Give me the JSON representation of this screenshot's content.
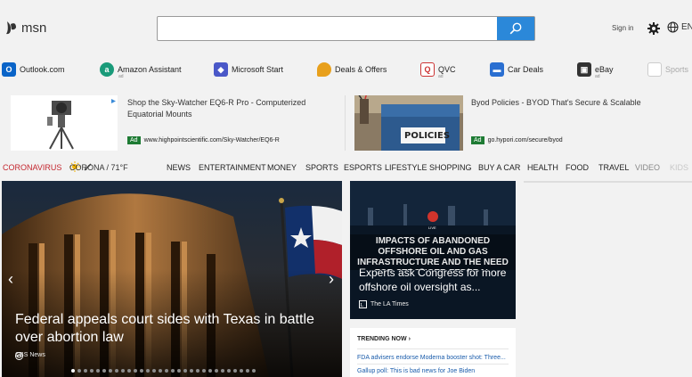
{
  "header": {
    "logo_text": "msn",
    "search_value": "",
    "sign_in": "Sign in",
    "lang": "EN"
  },
  "quick_links": [
    {
      "label": "Outlook.com",
      "icon": "outlook-icon",
      "ad": ""
    },
    {
      "label": "Amazon Assistant",
      "icon": "amazon-icon",
      "ad": "ad"
    },
    {
      "label": "Microsoft Start",
      "icon": "microsoft-start-icon",
      "ad": ""
    },
    {
      "label": "Deals & Offers",
      "icon": "deals-icon",
      "ad": ""
    },
    {
      "label": "QVC",
      "icon": "qvc-icon",
      "ad": "ad"
    },
    {
      "label": "Car Deals",
      "icon": "car-icon",
      "ad": ""
    },
    {
      "label": "eBay",
      "icon": "ebay-icon",
      "ad": "ad"
    },
    {
      "label": "Sports",
      "icon": "sports-icon",
      "ad": ""
    }
  ],
  "ads": [
    {
      "title": "Shop the Sky-Watcher EQ6-R Pro - Computerized Equatorial Mounts",
      "tag": "Ad",
      "url": "www.highpointscientific.com/Sky-Watcher/EQ6-R"
    },
    {
      "title": "Byod Policies - BYOD That's Secure & Scalable",
      "tag": "Ad",
      "url": "go.hypori.com/secure/byod",
      "image_text": "POLICIES"
    }
  ],
  "nav": {
    "corona": "CORONAVIRUS",
    "weather": "CORONA / 71°F",
    "items": [
      "NEWS",
      "ENTERTAINMENT",
      "MONEY",
      "SPORTS",
      "ESPORTS",
      "LIFESTYLE",
      "SHOPPING",
      "BUY A CAR",
      "HEALTH",
      "FOOD",
      "TRAVEL",
      "VIDEO",
      "KIDS"
    ]
  },
  "hero": {
    "title": "Federal appeals court sides with Texas in battle over abortion law",
    "source": "CBS News",
    "slides_total": 30,
    "slide_active": 0
  },
  "card2": {
    "image_text": "IMPACTS OF ABANDONED OFFSHORE OIL AND GAS INFRASTRUCTURE AND THE NEED FOR STRONGER FEDERAL OVERSIGHT",
    "title": "Experts ask Congress for more offshore oil oversight as...",
    "source": "The LA Times",
    "badge": "LIVE"
  },
  "trending": {
    "heading": "TRENDING NOW",
    "items": [
      "FDA advisers endorse Moderna booster shot: Three...",
      "Gallup poll: This is bad news for Joe Biden"
    ]
  },
  "colors": {
    "accent": "#2b88d9",
    "corona": "#c4262e",
    "ad_tag": "#1e7b34",
    "link": "#1a5cab"
  }
}
